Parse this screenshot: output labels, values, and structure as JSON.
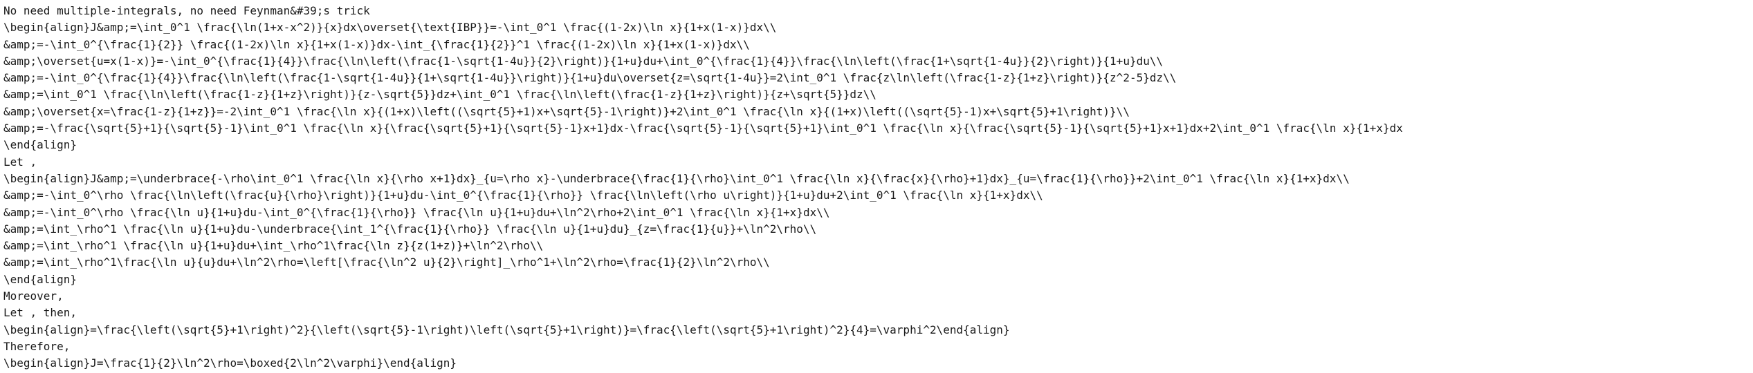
{
  "document": {
    "lines": [
      "No need multiple-integrals, no need Feynman&#39;s trick",
      "\\begin{align}J&amp;=\\int_0^1 \\frac{\\ln(1+x-x^2)}{x}dx\\overset{\\text{IBP}}=-\\int_0^1 \\frac{(1-2x)\\ln x}{1+x(1-x)}dx\\\\",
      "&amp;=-\\int_0^{\\frac{1}{2}} \\frac{(1-2x)\\ln x}{1+x(1-x)}dx-\\int_{\\frac{1}{2}}^1 \\frac{(1-2x)\\ln x}{1+x(1-x)}dx\\\\",
      "&amp;\\overset{u=x(1-x)}=-\\int_0^{\\frac{1}{4}}\\frac{\\ln\\left(\\frac{1-\\sqrt{1-4u}}{2}\\right)}{1+u}du+\\int_0^{\\frac{1}{4}}\\frac{\\ln\\left(\\frac{1+\\sqrt{1-4u}}{2}\\right)}{1+u}du\\\\",
      "&amp;=-\\int_0^{\\frac{1}{4}}\\frac{\\ln\\left(\\frac{1-\\sqrt{1-4u}}{1+\\sqrt{1-4u}}\\right)}{1+u}du\\overset{z=\\sqrt{1-4u}}=2\\int_0^1 \\frac{z\\ln\\left(\\frac{1-z}{1+z}\\right)}{z^2-5}dz\\\\",
      "&amp;=\\int_0^1 \\frac{\\ln\\left(\\frac{1-z}{1+z}\\right)}{z-\\sqrt{5}}dz+\\int_0^1 \\frac{\\ln\\left(\\frac{1-z}{1+z}\\right)}{z+\\sqrt{5}}dz\\\\",
      "&amp;\\overset{x=\\frac{1-z}{1+z}}=-2\\int_0^1 \\frac{\\ln x}{(1+x)\\left((\\sqrt{5}+1)x+\\sqrt{5}-1\\right)}+2\\int_0^1 \\frac{\\ln x}{(1+x)\\left((\\sqrt{5}-1)x+\\sqrt{5}+1\\right)}\\\\",
      "&amp;=-\\frac{\\sqrt{5}+1}{\\sqrt{5}-1}\\int_0^1 \\frac{\\ln x}{\\frac{\\sqrt{5}+1}{\\sqrt{5}-1}x+1}dx-\\frac{\\sqrt{5}-1}{\\sqrt{5}+1}\\int_0^1 \\frac{\\ln x}{\\frac{\\sqrt{5}-1}{\\sqrt{5}+1}x+1}dx+2\\int_0^1 \\frac{\\ln x}{1+x}dx",
      "\\end{align}",
      "Let ,",
      "\\begin{align}J&amp;=\\underbrace{-\\rho\\int_0^1 \\frac{\\ln x}{\\rho x+1}dx}_{u=\\rho x}-\\underbrace{\\frac{1}{\\rho}\\int_0^1 \\frac{\\ln x}{\\frac{x}{\\rho}+1}dx}_{u=\\frac{1}{\\rho}}+2\\int_0^1 \\frac{\\ln x}{1+x}dx\\\\",
      "&amp;=-\\int_0^\\rho \\frac{\\ln\\left(\\frac{u}{\\rho}\\right)}{1+u}du-\\int_0^{\\frac{1}{\\rho}} \\frac{\\ln\\left(\\rho u\\right)}{1+u}du+2\\int_0^1 \\frac{\\ln x}{1+x}dx\\\\",
      "&amp;=-\\int_0^\\rho \\frac{\\ln u}{1+u}du-\\int_0^{\\frac{1}{\\rho}} \\frac{\\ln u}{1+u}du+\\ln^2\\rho+2\\int_0^1 \\frac{\\ln x}{1+x}dx\\\\",
      "&amp;=\\int_\\rho^1 \\frac{\\ln u}{1+u}du-\\underbrace{\\int_1^{\\frac{1}{\\rho}} \\frac{\\ln u}{1+u}du}_{z=\\frac{1}{u}}+\\ln^2\\rho\\\\",
      "&amp;=\\int_\\rho^1 \\frac{\\ln u}{1+u}du+\\int_\\rho^1\\frac{\\ln z}{z(1+z)}+\\ln^2\\rho\\\\",
      "&amp;=\\int_\\rho^1\\frac{\\ln u}{u}du+\\ln^2\\rho=\\left[\\frac{\\ln^2 u}{2}\\right]_\\rho^1+\\ln^2\\rho=\\frac{1}{2}\\ln^2\\rho\\\\",
      "\\end{align}",
      "Moreover,",
      "Let , then,",
      "\\begin{align}=\\frac{\\left(\\sqrt{5}+1\\right)^2}{\\left(\\sqrt{5}-1\\right)\\left(\\sqrt{5}+1\\right)}=\\frac{\\left(\\sqrt{5}+1\\right)^2}{4}=\\varphi^2\\end{align}",
      "Therefore,",
      "\\begin{align}J=\\frac{1}{2}\\ln^2\\rho=\\boxed{2\\ln^2\\varphi}\\end{align}"
    ]
  }
}
